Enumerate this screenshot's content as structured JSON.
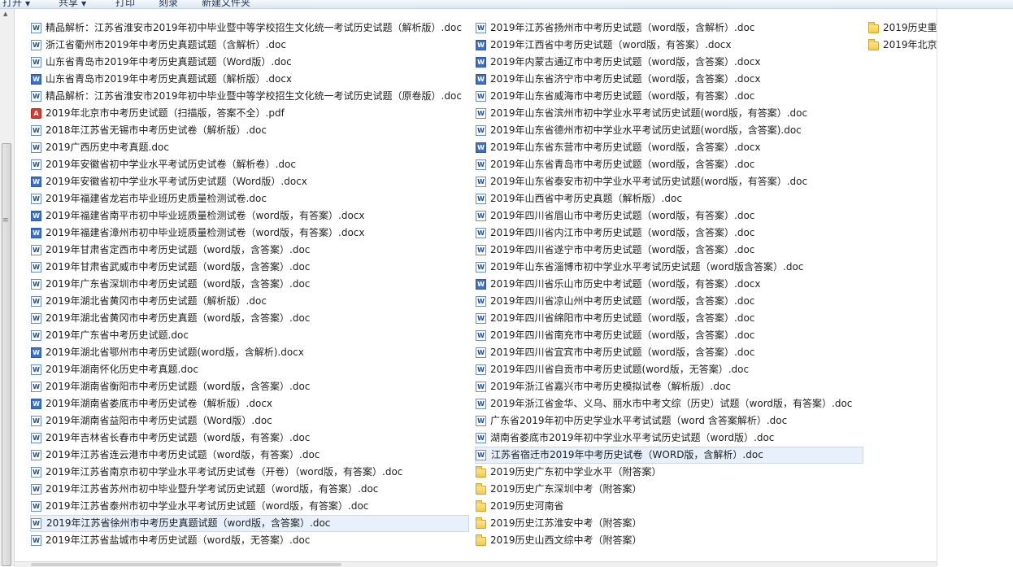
{
  "toolbar": {
    "open_label": "打开",
    "share_label": "共享",
    "print_label": "打印",
    "burn_label": "刻录",
    "new_folder_label": "新建文件夹"
  },
  "files_col1": [
    {
      "name": "精品解析：江苏省淮安市2019年初中毕业暨中等学校招生文化统一考试历史试题（解析版）.doc",
      "icon": "doc"
    },
    {
      "name": "浙江省衢州市2019年中考历史真题试题（含解析）.doc",
      "icon": "doc"
    },
    {
      "name": "山东省青岛市2019年中考历史真题试题（Word版）.doc",
      "icon": "doc"
    },
    {
      "name": "山东省青岛市2019年中考历史真题试题（解析版）.docx",
      "icon": "docx"
    },
    {
      "name": "精品解析：江苏省淮安市2019年初中毕业暨中等学校招生文化统一考试历史试题（原卷版）.doc",
      "icon": "doc"
    },
    {
      "name": "2019年北京市中考历史试题（扫描版，答案不全）.pdf",
      "icon": "pdf"
    },
    {
      "name": "2018年江苏省无锡市中考历史试卷（解析版）.doc",
      "icon": "doc"
    },
    {
      "name": "2019广西历史中考真题.doc",
      "icon": "doc"
    },
    {
      "name": "2019年安徽省初中学业水平考试历史试卷（解析卷）.doc",
      "icon": "doc"
    },
    {
      "name": "2019年安徽省初中学业水平考试历史试题（Word版）.docx",
      "icon": "docx"
    },
    {
      "name": "2019年福建省龙岩市毕业班历史质量检测试卷.doc",
      "icon": "doc"
    },
    {
      "name": "2019年福建省南平市初中毕业班质量检测试卷（word版，有答案）.docx",
      "icon": "docx"
    },
    {
      "name": "2019年福建省漳州市初中毕业班质量检测试卷（word版，有答案）.docx",
      "icon": "docx"
    },
    {
      "name": "2019年甘肃省定西市中考历史试题（word版，含答案）.doc",
      "icon": "doc"
    },
    {
      "name": "2019年甘肃省武威市中考历史试题（word版，含答案）.doc",
      "icon": "doc"
    },
    {
      "name": "2019年广东省深圳市中考历史试题（word版，含答案）.doc",
      "icon": "doc"
    },
    {
      "name": "2019年湖北省黄冈市中考历史试题（解析版）.doc",
      "icon": "doc"
    },
    {
      "name": "2019年湖北省黄冈市中考历史真题（word版，含答案）.doc",
      "icon": "doc"
    },
    {
      "name": "2019年广东省中考历史试题.doc",
      "icon": "doc"
    },
    {
      "name": "2019年湖北省鄂州市中考历史试题(word版，含解析).docx",
      "icon": "docx"
    },
    {
      "name": "2019年湖南怀化历史中考真题.doc",
      "icon": "doc"
    },
    {
      "name": "2019年湖南省衡阳市中考历史试题（word版，含答案）.doc",
      "icon": "doc"
    },
    {
      "name": "2019年湖南省娄底市中考历史试卷（解析版）.docx",
      "icon": "docx"
    },
    {
      "name": "2019年湖南省益阳市中考历史试题（Word版）.doc",
      "icon": "doc"
    },
    {
      "name": "2019年吉林省长春市中考历史试题（word版，有答案）.doc",
      "icon": "doc"
    },
    {
      "name": "2019年江苏省连云港市中考历史试题（word版，有答案）.doc",
      "icon": "doc"
    },
    {
      "name": "2019年江苏省南京市初中学业水平考试历史试卷（开卷）（word版，有答案）.doc",
      "icon": "doc"
    },
    {
      "name": "2019年江苏省苏州市初中毕业暨升学考试历史试题（word版，有答案）.doc",
      "icon": "doc"
    },
    {
      "name": "2019年江苏省泰州市初中学业水平考试历史试题（word版，有答案）.doc",
      "icon": "doc"
    },
    {
      "name": "2019年江苏省徐州市中考历史真题试题（word版，含答案）.doc",
      "icon": "doc",
      "selected": true
    },
    {
      "name": "2019年江苏省盐城市中考历史试题（word版，无答案）.doc",
      "icon": "doc"
    }
  ],
  "files_col2": [
    {
      "name": "2019年江苏省扬州市中考历史试题（word版，含解析）.doc",
      "icon": "doc"
    },
    {
      "name": "2019年江西省中考历史试题（word版，有答案）.docx",
      "icon": "docx"
    },
    {
      "name": "2019年内蒙古通辽市中考历史试题（word版，含答案）.docx",
      "icon": "docx"
    },
    {
      "name": "2019年山东省济宁市中考历史试题（word版，含答案）.docx",
      "icon": "docx"
    },
    {
      "name": "2019年山东省威海市中考历史试题（word版，有答案）.doc",
      "icon": "doc"
    },
    {
      "name": "2019年山东省滨州市初中学业水平考试历史试题(word版，有答案）.doc",
      "icon": "doc"
    },
    {
      "name": "2019年山东省德州市初中学业水平考试历史试题(word版，含答案).doc",
      "icon": "doc"
    },
    {
      "name": "2019年山东省东营市中考历史试题（word版，含答案）.docx",
      "icon": "docx"
    },
    {
      "name": "2019年山东省青岛市中考历史试题（word版，含答案）.doc",
      "icon": "doc"
    },
    {
      "name": "2019年山东省泰安市初中学业水平考试历史试题(word版，有答案）.doc",
      "icon": "doc"
    },
    {
      "name": "2019年山西省中考历史真题（解析版）.doc",
      "icon": "doc"
    },
    {
      "name": "2019年四川省眉山市中考历史试题（word版，有答案）.doc",
      "icon": "doc"
    },
    {
      "name": "2019年四川省内江市中考历史试题（word版，含答案）.doc",
      "icon": "doc"
    },
    {
      "name": "2019年四川省遂宁市中考历史试题（word版，含答案）.doc",
      "icon": "doc"
    },
    {
      "name": "2019年山东省淄博市初中学业水平考试历史试题（word版含答案）.doc",
      "icon": "doc"
    },
    {
      "name": "2019年四川省乐山市历史中考试题（word版，有答案）.docx",
      "icon": "docx"
    },
    {
      "name": "2019年四川省凉山州中考历史试题（word版，含答案）.doc",
      "icon": "doc"
    },
    {
      "name": "2019年四川省绵阳市中考历史试题（word版，含答案）.doc",
      "icon": "doc"
    },
    {
      "name": "2019年四川省南充市中考历史试题（word版，含答案）.doc",
      "icon": "doc"
    },
    {
      "name": "2019年四川省宜宾市中考历史试题（word版，含答案）.doc",
      "icon": "doc"
    },
    {
      "name": "2019年四川省自贡市中考历史试题(word版，无答案）.doc",
      "icon": "doc"
    },
    {
      "name": "2019年浙江省嘉兴市中考历史模拟试卷（解析版）.doc",
      "icon": "doc"
    },
    {
      "name": "2019年浙江省金华、义乌、丽水市中考文综（历史）试题（word版，有答案）.doc",
      "icon": "doc"
    },
    {
      "name": "广东省2019年初中历史学业水平考试试题（word 含答案解析）.doc",
      "icon": "doc"
    },
    {
      "name": "湖南省娄底市2019年初中学业水平考试历史试题（word版）.doc",
      "icon": "doc"
    },
    {
      "name": "江苏省宿迁市2019年中考历史试卷（WORD版，含解析）.doc",
      "icon": "doc",
      "selected": true
    },
    {
      "name": "2019历史广东初中学业水平（附答案）",
      "icon": "folder"
    },
    {
      "name": "2019历史广东深圳中考（附答案）",
      "icon": "folder"
    },
    {
      "name": "2019历史河南省",
      "icon": "folder"
    },
    {
      "name": "2019历史江苏淮安中考（附答案）",
      "icon": "folder"
    },
    {
      "name": "2019历史山西文综中考（附答案）",
      "icon": "folder"
    }
  ],
  "files_col3": [
    {
      "name": "2019历史重庆",
      "icon": "folder"
    },
    {
      "name": "2019年北京中",
      "icon": "folder"
    }
  ]
}
